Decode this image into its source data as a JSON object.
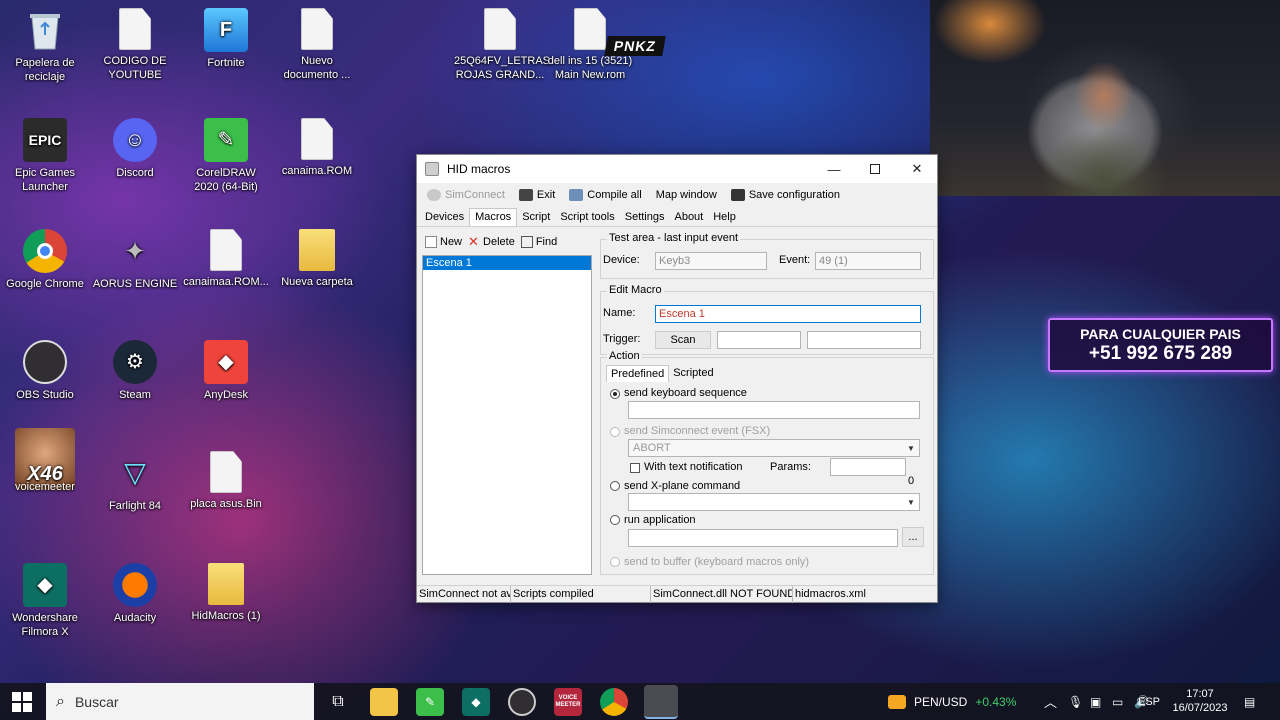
{
  "desktop": {
    "icons": [
      {
        "label": "Papelera de reciclaje"
      },
      {
        "label": "CODIGO DE YOUTUBE"
      },
      {
        "label": "Fortnite"
      },
      {
        "label": "Nuevo documento ..."
      },
      {
        "label": "25Q64FV_LETRAS ROJAS GRAND..."
      },
      {
        "label": "dell ins 15 (3521) Main New.rom"
      },
      {
        "label": "Epic Games Launcher"
      },
      {
        "label": "Discord"
      },
      {
        "label": "CorelDRAW 2020 (64-Bit)"
      },
      {
        "label": "canaima.ROM"
      },
      {
        "label": "Google Chrome"
      },
      {
        "label": "AORUS ENGINE"
      },
      {
        "label": "canaimaa.ROM..."
      },
      {
        "label": "Nueva carpeta"
      },
      {
        "label": "OBS Studio"
      },
      {
        "label": "Steam"
      },
      {
        "label": "AnyDesk"
      },
      {
        "label": "voicemeeter"
      },
      {
        "label": "Farlight 84"
      },
      {
        "label": "placa asus.Bin"
      },
      {
        "label": "Wondershare Filmora X"
      },
      {
        "label": "Audacity"
      },
      {
        "label": "HidMacros (1)"
      }
    ],
    "overlay_badge": "X46",
    "logo_text": "PNKZ",
    "promo": {
      "line1": "PARA CUALQUIER PAIS",
      "line2": "+51 992 675 289"
    }
  },
  "window": {
    "title": "HID macros",
    "toolbar": {
      "simconnect": "SimConnect",
      "exit": "Exit",
      "compile_all": "Compile all",
      "map_window": "Map window",
      "save_configuration": "Save configuration"
    },
    "tabs": [
      "Devices",
      "Macros",
      "Script",
      "Script tools",
      "Settings",
      "About",
      "Help"
    ],
    "active_tab": "Macros",
    "macro_toolbar": {
      "new": "New",
      "delete": "Delete",
      "find": "Find"
    },
    "macros": [
      "Escena 1"
    ],
    "test_area": {
      "group_label": "Test area - last input event",
      "device_label": "Device:",
      "device_value": "Keyb3",
      "event_label": "Event:",
      "event_value": "49  (1)"
    },
    "edit_macro": {
      "group_label": "Edit Macro",
      "name_label": "Name:",
      "name_value": "Escena 1",
      "trigger_label": "Trigger:",
      "scan_button": "Scan"
    },
    "action": {
      "group_label": "Action",
      "subtabs": [
        "Predefined",
        "Scripted"
      ],
      "send_keyboard_sequence": "send keyboard sequence",
      "send_simconnect_event": "send Simconnect event (FSX)",
      "abort_option": "ABORT",
      "with_text_notification": "With text notification",
      "params_label": "Params:",
      "zero_value": "0",
      "send_xplane_command": "send X-plane command",
      "run_application": "run application",
      "browse_button": "...",
      "send_to_buffer": "send to buffer (keyboard macros only)"
    },
    "statusbar": [
      "SimConnect not av",
      "Scripts compiled",
      "SimConnect.dll NOT FOUND",
      "hidmacros.xml"
    ]
  },
  "taskbar": {
    "search_placeholder": "Buscar",
    "apps": [
      "task-view",
      "file-explorer",
      "coreldraw",
      "filmora",
      "obs",
      "voicemeeter",
      "chrome",
      "hidmacros"
    ],
    "voicemeeter_label": "VOICE MEETER",
    "currency": "PEN/USD",
    "currency_change": "+0.43%",
    "language": "ESP",
    "time": "17:07",
    "date": "16/07/2023"
  },
  "colors": {
    "selection": "#0078d7",
    "positive": "#3ecf6a",
    "promo_border": "#c678ff"
  }
}
